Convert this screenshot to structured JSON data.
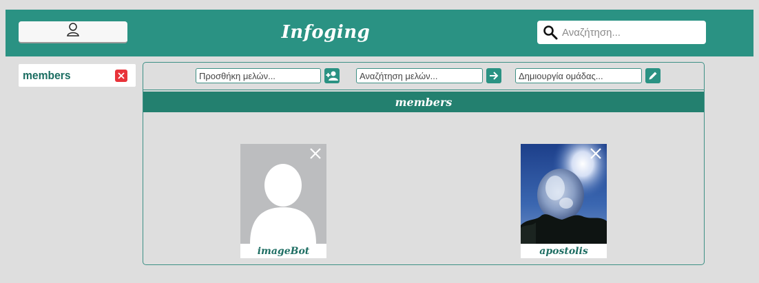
{
  "header": {
    "brand": "Infoging",
    "search_placeholder": "Αναζήτηση...",
    "background": "#2a9283"
  },
  "sidebar": {
    "tab_label": "members"
  },
  "toolbar": {
    "add_members_placeholder": "Προσθήκη μελών...",
    "search_members_placeholder": "Αναζήτηση μελών...",
    "create_group_placeholder": "Δημιουργία ομάδας..."
  },
  "section": {
    "title": "members"
  },
  "members": [
    {
      "name": "imageBot",
      "photo": "default-avatar"
    },
    {
      "name": "apostolis",
      "photo": "bubble-photo"
    }
  ],
  "colors": {
    "accent": "#2a9283",
    "section_bar": "#23806f",
    "name_text": "#1e6e63",
    "close_red": "#e8333a"
  }
}
